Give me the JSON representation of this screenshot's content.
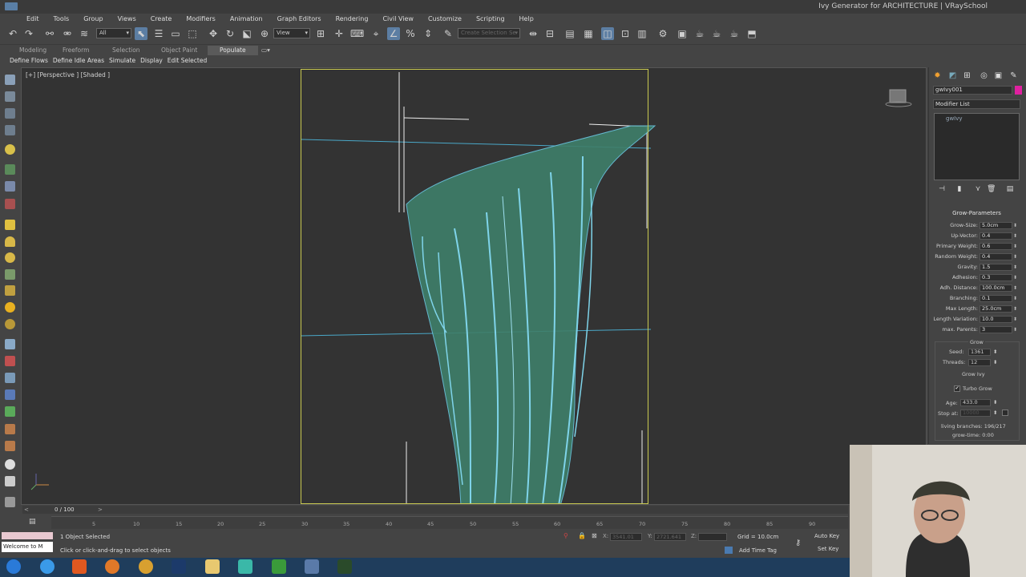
{
  "window": {
    "title": "Ivy Generator for ARCHITECTURE | VRaySchool"
  },
  "menu": [
    "Edit",
    "Tools",
    "Group",
    "Views",
    "Create",
    "Modifiers",
    "Animation",
    "Graph Editors",
    "Rendering",
    "Civil View",
    "Customize",
    "Scripting",
    "Help"
  ],
  "toolbar": {
    "selection_filter": "All",
    "reference_coord": "View",
    "selection_set_placeholder": "Create Selection Se"
  },
  "ribbon": {
    "tabs": [
      "Modeling",
      "Freeform",
      "Selection",
      "Object Paint",
      "Populate"
    ],
    "active_tab": "Populate",
    "buttons": [
      "Define Flows",
      "Define Idle Areas",
      "Simulate",
      "Display",
      "Edit Selected"
    ]
  },
  "viewport": {
    "label": "[+] [Perspective ] [Shaded ]"
  },
  "command_panel": {
    "object_name": "gwIvy001",
    "object_color": "#e020a0",
    "modifier_list": "Modifier List",
    "stack_items": [
      "gwIvy"
    ],
    "rollout_title": "Grow-Parameters",
    "params": [
      {
        "label": "Grow-Size:",
        "value": "5.0cm"
      },
      {
        "label": "Up-Vector:",
        "value": "0.4"
      },
      {
        "label": "Primary Weight:",
        "value": "0.6"
      },
      {
        "label": "Random Weight:",
        "value": "0.4"
      },
      {
        "label": "Gravity:",
        "value": "1.5"
      },
      {
        "label": "Adhesion:",
        "value": "0.3"
      },
      {
        "label": "Adh. Distance:",
        "value": "100.0cm"
      },
      {
        "label": "Branching:",
        "value": "0.1"
      },
      {
        "label": "Max Length:",
        "value": "25.0cm"
      },
      {
        "label": "Length Variation:",
        "value": "10.0"
      },
      {
        "label": "max. Parents:",
        "value": "3"
      }
    ],
    "grow_group": {
      "title": "Grow",
      "seed_label": "Seed:",
      "seed_value": "1361",
      "threads_label": "Threads:",
      "threads_value": "12",
      "grow_button": "Grow Ivy",
      "turbo_label": "Turbo Grow",
      "turbo_checked": true,
      "age_label": "Age:",
      "age_value": "433.0",
      "stop_label": "Stop at:",
      "stop_value": "10000",
      "living_branches": "living branches: 196/217",
      "grow_time": "grow-time: 0:00"
    }
  },
  "timeline": {
    "frame_counter": "0 / 100",
    "ticks": [
      "5",
      "10",
      "15",
      "20",
      "25",
      "30",
      "35",
      "40",
      "45",
      "50",
      "55",
      "60",
      "65",
      "70",
      "75",
      "80",
      "85",
      "90"
    ]
  },
  "status": {
    "maxscript_text": "Welcome to M",
    "selected": "1 Object Selected",
    "prompt": "Click or click-and-drag to select objects",
    "x_label": "X:",
    "x_value": "3541.01",
    "y_label": "Y:",
    "y_value": "2721.641",
    "z_label": "Z:",
    "z_value": "",
    "grid": "Grid = 10.0cm",
    "add_time_tag": "Add Time Tag",
    "auto_key": "Auto Key",
    "set_key": "Set Key"
  }
}
